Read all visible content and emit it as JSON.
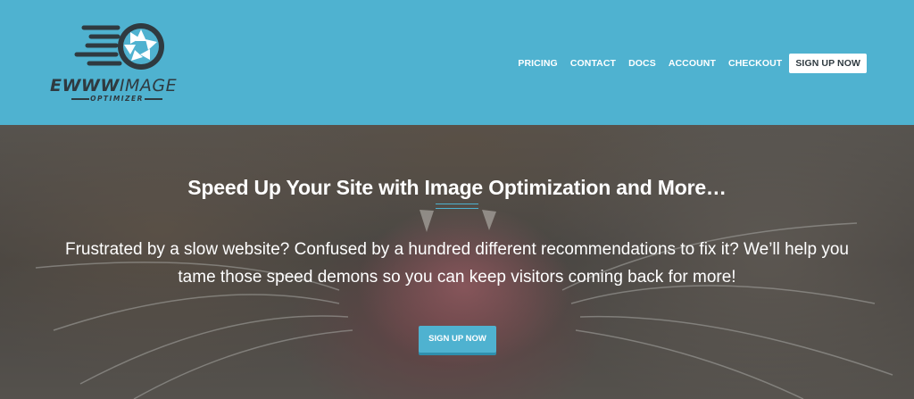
{
  "logo": {
    "word_bold": "EWWW",
    "word_light": "IMAGE",
    "sub": "OPTIMIZER"
  },
  "nav": {
    "items": [
      "PRICING",
      "CONTACT",
      "DOCS",
      "ACCOUNT",
      "CHECKOUT"
    ],
    "signup": "SIGN UP NOW"
  },
  "hero": {
    "title": "Speed Up Your Site with Image Optimization and More…",
    "text": "Frustrated by a slow website? Confused by a hundred different recommendations to fix it? We’ll help you tame those speed demons so you can keep visitors coming back for more!",
    "cta": "SIGN UP NOW"
  },
  "colors": {
    "brand": "#4fb2d0",
    "dark": "#2f3a40"
  }
}
